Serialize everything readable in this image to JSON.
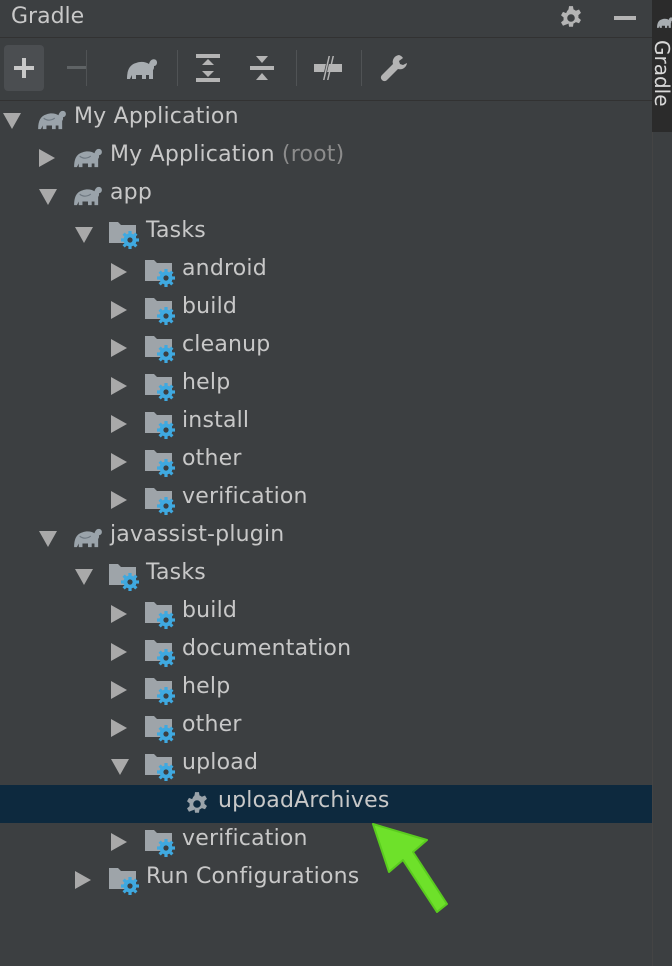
{
  "header": {
    "title": "Gradle",
    "settings_icon": "gear-icon",
    "minimize_icon": "minimize-icon"
  },
  "toolbar": {
    "buttons": [
      {
        "name": "link-project-button",
        "icon": "plus-icon",
        "tooltip": "Link Gradle Project"
      },
      {
        "name": "unlink-project-button",
        "icon": "minus-icon",
        "tooltip": "Unlink Gradle Project"
      },
      {
        "name": "execute-task-button",
        "icon": "elephant-icon",
        "tooltip": "Execute Gradle Task"
      },
      {
        "name": "expand-all-button",
        "icon": "expand-all-icon",
        "tooltip": "Expand All"
      },
      {
        "name": "collapse-all-button",
        "icon": "collapse-all-icon",
        "tooltip": "Collapse All"
      },
      {
        "name": "offline-mode-button",
        "icon": "offline-icon",
        "tooltip": "Toggle Offline Mode"
      },
      {
        "name": "gradle-settings-button",
        "icon": "wrench-icon",
        "tooltip": "Gradle Settings"
      }
    ]
  },
  "side_tab": {
    "label": "Gradle"
  },
  "tree": [
    {
      "label": "My Application",
      "suffix": "",
      "depth": 0,
      "expander": "down",
      "icon": "elephant"
    },
    {
      "label": "My Application",
      "suffix": "(root)",
      "depth": 1,
      "expander": "right",
      "icon": "elephant"
    },
    {
      "label": "app",
      "suffix": "",
      "depth": 1,
      "expander": "down",
      "icon": "elephant"
    },
    {
      "label": "Tasks",
      "suffix": "",
      "depth": 2,
      "expander": "down",
      "icon": "folder-gear"
    },
    {
      "label": "android",
      "suffix": "",
      "depth": 3,
      "expander": "right",
      "icon": "folder-gear"
    },
    {
      "label": "build",
      "suffix": "",
      "depth": 3,
      "expander": "right",
      "icon": "folder-gear"
    },
    {
      "label": "cleanup",
      "suffix": "",
      "depth": 3,
      "expander": "right",
      "icon": "folder-gear"
    },
    {
      "label": "help",
      "suffix": "",
      "depth": 3,
      "expander": "right",
      "icon": "folder-gear"
    },
    {
      "label": "install",
      "suffix": "",
      "depth": 3,
      "expander": "right",
      "icon": "folder-gear"
    },
    {
      "label": "other",
      "suffix": "",
      "depth": 3,
      "expander": "right",
      "icon": "folder-gear"
    },
    {
      "label": "verification",
      "suffix": "",
      "depth": 3,
      "expander": "right",
      "icon": "folder-gear"
    },
    {
      "label": "javassist-plugin",
      "suffix": "",
      "depth": 1,
      "expander": "down",
      "icon": "elephant"
    },
    {
      "label": "Tasks",
      "suffix": "",
      "depth": 2,
      "expander": "down",
      "icon": "folder-gear"
    },
    {
      "label": "build",
      "suffix": "",
      "depth": 3,
      "expander": "right",
      "icon": "folder-gear"
    },
    {
      "label": "documentation",
      "suffix": "",
      "depth": 3,
      "expander": "right",
      "icon": "folder-gear"
    },
    {
      "label": "help",
      "suffix": "",
      "depth": 3,
      "expander": "right",
      "icon": "folder-gear"
    },
    {
      "label": "other",
      "suffix": "",
      "depth": 3,
      "expander": "right",
      "icon": "folder-gear"
    },
    {
      "label": "upload",
      "suffix": "",
      "depth": 3,
      "expander": "down",
      "icon": "folder-gear"
    },
    {
      "label": "uploadArchives",
      "suffix": "",
      "depth": 4,
      "expander": "none",
      "icon": "gear",
      "selected": true
    },
    {
      "label": "verification",
      "suffix": "",
      "depth": 3,
      "expander": "right",
      "icon": "folder-gear"
    },
    {
      "label": "Run Configurations",
      "suffix": "",
      "depth": 2,
      "expander": "right",
      "icon": "folder-gear"
    }
  ],
  "colors": {
    "background": "#3c3f41",
    "selection": "#0d293e",
    "accent_gear": "#3fa9e0",
    "annotation_arrow": "#6ee12a"
  }
}
